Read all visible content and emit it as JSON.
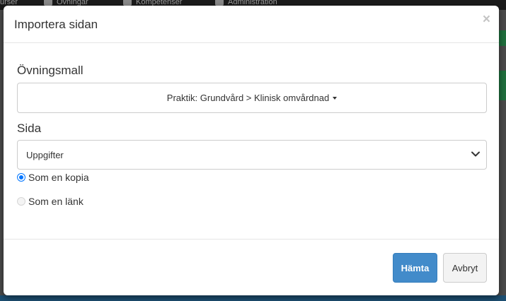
{
  "background": {
    "nav_items": [
      "urser",
      "Övningar",
      "Kompetenser",
      "Administration"
    ]
  },
  "modal": {
    "title": "Importera sidan",
    "close_glyph": "×",
    "template_label": "Övningsmall",
    "template_value": "Praktik: Grundvård > Klinisk omvårdnad",
    "page_label": "Sida",
    "page_select_value": "Uppgifter",
    "radio_options": [
      {
        "label": "Som en kopia",
        "checked": true
      },
      {
        "label": "Som en länk",
        "checked": false
      }
    ],
    "primary_button": "Hämta",
    "cancel_button": "Avbryt"
  },
  "colors": {
    "primary": "#428bca",
    "radio_accent": "#0075ff",
    "backdrop": "#4a4a4a"
  }
}
